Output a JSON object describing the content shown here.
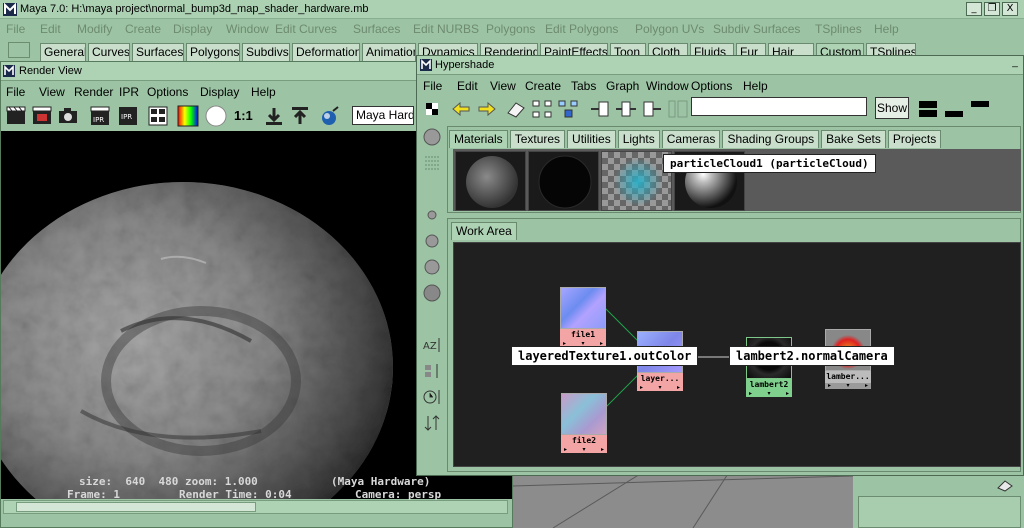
{
  "main_window": {
    "title": "Maya 7.0: H:\\maya project\\normal_bump3d_map_shader_hardware.mb",
    "menu": [
      "File",
      "Edit",
      "Modify",
      "Create",
      "Display",
      "Window",
      "Edit Curves",
      "Surfaces",
      "Edit NURBS",
      "Polygons",
      "Edit Polygons",
      "Polygon UVs",
      "Subdiv Surfaces",
      "TSplines",
      "Help"
    ],
    "window_buttons": [
      "_",
      "❐",
      "X"
    ],
    "shelf_tabs": [
      "General",
      "Curves",
      "Surfaces",
      "Polygons",
      "Subdivs",
      "Deformation",
      "Animation",
      "Dynamics",
      "Rendering",
      "PaintEffects",
      "Toon",
      "Cloth",
      "Fluids",
      "Fur",
      "Hair",
      "Custom",
      "TSplines"
    ]
  },
  "render_view": {
    "title": "Render View",
    "menu": [
      "File",
      "View",
      "Render",
      "IPR",
      "Options",
      "Display",
      "Help"
    ],
    "ratio_label": "1:1",
    "renderer_select": "Maya Hardware",
    "info": {
      "size_line": "size:  640  480 zoom: 1.000",
      "frame_line": "Frame: 1",
      "render_time": "Render Time: 0:04",
      "renderer": "(Maya Hardware)",
      "camera": "Camera: persp"
    }
  },
  "hypershade": {
    "title": "Hypershade",
    "minimize": "_",
    "menu": [
      "File",
      "Edit",
      "View",
      "Create",
      "Tabs",
      "Graph",
      "Window",
      "Options",
      "Help"
    ],
    "search_value": "",
    "show_label": "Show",
    "top_tabs": [
      "Materials",
      "Textures",
      "Utilities",
      "Lights",
      "Cameras",
      "Shading Groups",
      "Bake Sets",
      "Projects"
    ],
    "active_top_tab": "Materials",
    "swatch_tooltip": "particleCloud1 (particleCloud)",
    "work_tab": "Work Area",
    "nodes": {
      "file1": "file1",
      "file2": "file2",
      "layered": "layer...",
      "lambert2": "lambert2",
      "lambert_other": "lamber..."
    },
    "connection_tooltip_left": "layeredTexture1.outColor",
    "connection_tooltip_right": "lambert2.normalCamera"
  }
}
